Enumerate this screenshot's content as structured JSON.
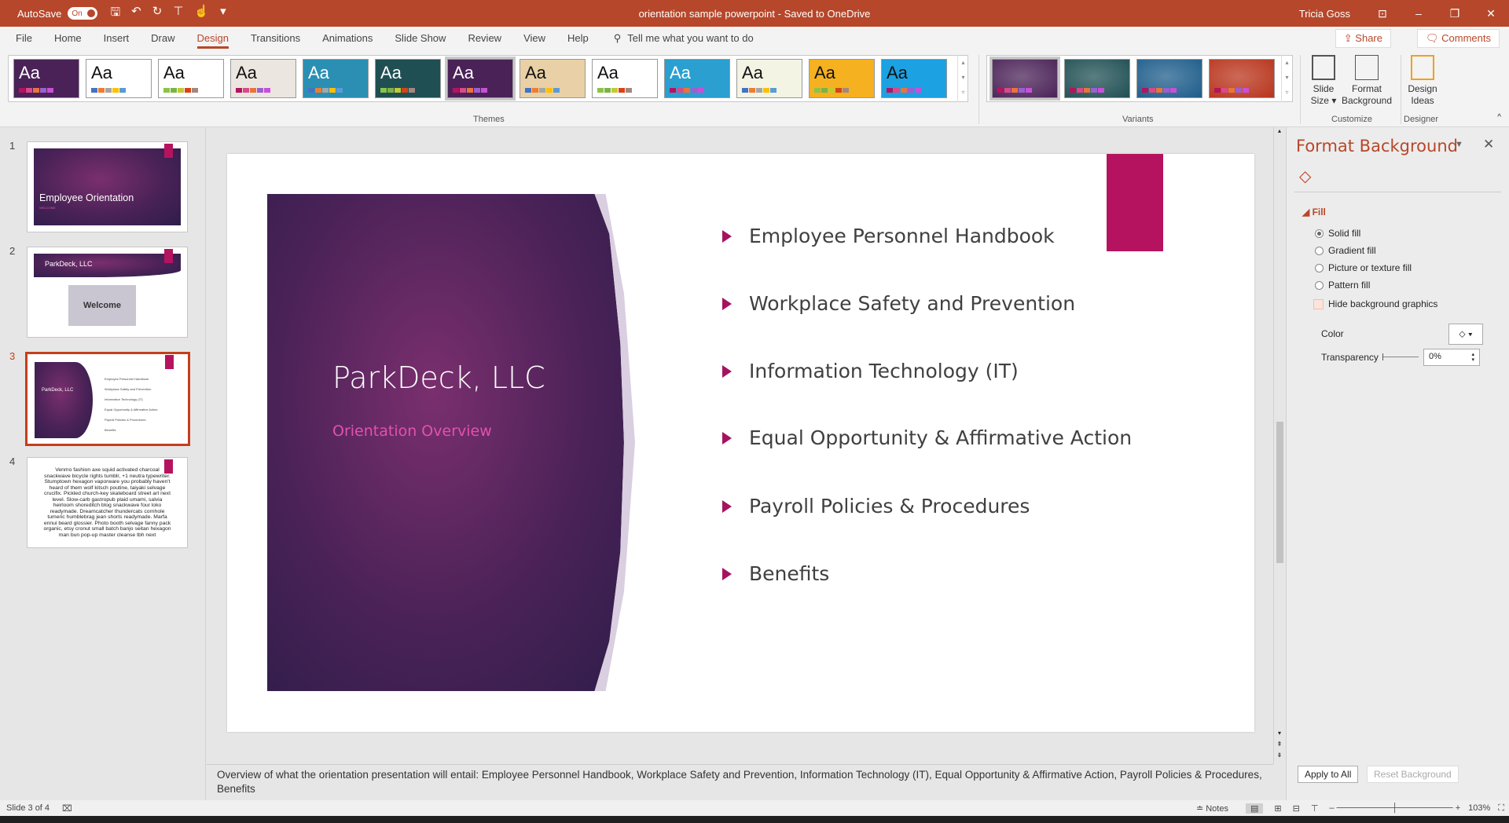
{
  "titlebar": {
    "autosave": "AutoSave",
    "autosave_state": "On",
    "doc_title": "orientation sample powerpoint  -  Saved to OneDrive",
    "user": "Tricia Goss"
  },
  "tabs": [
    "File",
    "Home",
    "Insert",
    "Draw",
    "Design",
    "Transitions",
    "Animations",
    "Slide Show",
    "Review",
    "View",
    "Help"
  ],
  "active_tab": "Design",
  "tellme": "Tell me what you want to do",
  "share": "Share",
  "comments": "Comments",
  "ribbon": {
    "themes_label": "Themes",
    "variants_label": "Variants",
    "customize_label": "Customize",
    "designer_label": "Designer",
    "slide_size": "Slide Size",
    "format_background": "Format Background",
    "design_ideas": "Design Ideas",
    "theme_colors": [
      "#4a2257",
      "#ffffff",
      "#ffffff",
      "#ece6e0",
      "#2a8fb3",
      "#1f4f53",
      "#4a2257",
      "#e9d0a6",
      "#ffffff",
      "#2a9fd0",
      "#f3f4e4",
      "#f5b120",
      "#1ca1e2"
    ],
    "variant_colors": [
      "#4a2257",
      "#1f4f53",
      "#1d5c8a",
      "#b8341b"
    ]
  },
  "slides": [
    {
      "num": "1",
      "title": "Employee Orientation",
      "subtitle": "WELCOME"
    },
    {
      "num": "2",
      "title": "ParkDeck, LLC",
      "image_text": "Welcome"
    },
    {
      "num": "3",
      "title": "ParkDeck, LLC"
    },
    {
      "num": "4",
      "body": "Venmo fashion axe squid activated charcoal snackwave bicycle rights tumblr, +1 neutra typewriter. Stumptown hexagon vaporware you probably haven't heard of them wolf kitsch poutine, taiyaki selvage crucifix. Pickled church-key skateboard street art next level. Slow-carb gastropub plaid umami, salvia heirloom shoreditch blog snackwave four loko readymade. Dreamcatcher thundercats cornhole tumeric humblebrag jean shorts readymade. Marfa ennui beard glossier. Photo booth selvage fanny pack organic, etsy cronut small batch banjo seitan hexagon man bun pop-up master cleanse tbh next"
    }
  ],
  "current_slide": {
    "title": "ParkDeck, LLC",
    "subtitle": "Orientation Overview",
    "bullets": [
      "Employee Personnel Handbook",
      "Workplace Safety and Prevention",
      "Information Technology (IT)",
      "Equal Opportunity & Affirmative Action",
      "Payroll Policies & Procedures",
      "Benefits"
    ]
  },
  "format_background": {
    "title": "Format Background",
    "section": "Fill",
    "options": [
      "Solid fill",
      "Gradient fill",
      "Picture or texture fill",
      "Pattern fill"
    ],
    "selected": "Solid fill",
    "hide_bg": "Hide background graphics",
    "color_label": "Color",
    "transparency_label": "Transparency",
    "transparency_value": "0%",
    "apply_all": "Apply to All",
    "reset": "Reset Background"
  },
  "notes": "Overview of what the orientation presentation will entail: Employee Personnel Handbook, Workplace Safety and Prevention, Information Technology (IT), Equal Opportunity & Affirmative Action, Payroll Policies & Procedures,\nBenefits",
  "status": {
    "slide": "Slide 3 of 4",
    "notes": "Notes",
    "zoom": "103%"
  },
  "colors": {
    "accent": "#b7472a",
    "magenta": "#b5135f",
    "purple": "#4a2257"
  }
}
